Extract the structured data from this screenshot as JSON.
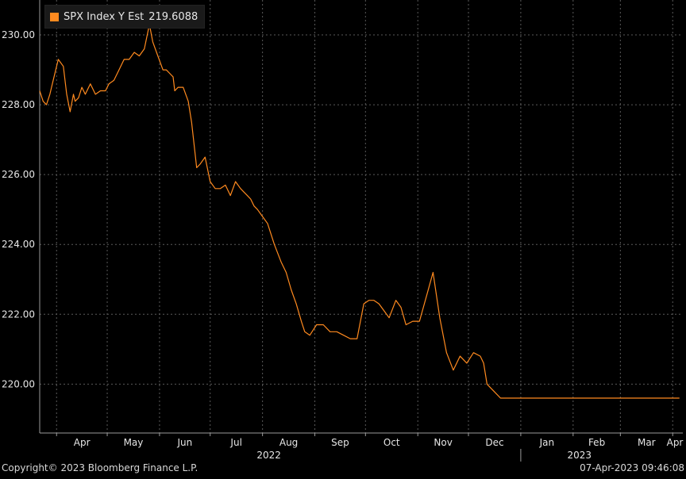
{
  "legend": {
    "label": "SPX Index Y Est",
    "value": "219.6088",
    "color": "#ff8a1f"
  },
  "footer": {
    "copyright": "Copyright© 2023 Bloomberg Finance L.P.",
    "timestamp": "07-Apr-2023 09:46:08"
  },
  "chart_data": {
    "type": "line",
    "ylim": [
      218.6,
      231.0
    ],
    "yticks": [
      220,
      222,
      224,
      226,
      228,
      230
    ],
    "ytick_labels": [
      "220.00",
      "222.00",
      "224.00",
      "226.00",
      "228.00",
      "230.00"
    ],
    "grid": true,
    "legend_position": "top-left",
    "x_range": [
      "2022-03-22",
      "2023-04-07"
    ],
    "months": [
      {
        "label": "Apr",
        "date": "2022-04-01"
      },
      {
        "label": "May",
        "date": "2022-05-01"
      },
      {
        "label": "Jun",
        "date": "2022-06-01"
      },
      {
        "label": "Jul",
        "date": "2022-07-01"
      },
      {
        "label": "Aug",
        "date": "2022-08-01"
      },
      {
        "label": "Sep",
        "date": "2022-09-01"
      },
      {
        "label": "Oct",
        "date": "2022-10-01"
      },
      {
        "label": "Nov",
        "date": "2022-11-01"
      },
      {
        "label": "Dec",
        "date": "2022-12-01"
      },
      {
        "label": "Jan",
        "date": "2023-01-01"
      },
      {
        "label": "Feb",
        "date": "2023-02-01"
      },
      {
        "label": "Mar",
        "date": "2023-03-01"
      },
      {
        "label": "Apr",
        "date": "2023-04-01"
      }
    ],
    "years": [
      {
        "label": "2022",
        "date": "2022-08-01"
      },
      {
        "label": "2023",
        "date": "2023-02-01"
      }
    ],
    "year_divider_date": "2023-01-01",
    "series": [
      {
        "color": "#ff8a1f",
        "x": [
          "2022-03-22",
          "2022-03-24",
          "2022-03-26",
          "2022-03-28",
          "2022-03-30",
          "2022-04-02",
          "2022-04-05",
          "2022-04-07",
          "2022-04-09",
          "2022-04-11",
          "2022-04-12",
          "2022-04-14",
          "2022-04-16",
          "2022-04-18",
          "2022-04-21",
          "2022-04-24",
          "2022-04-27",
          "2022-04-30",
          "2022-05-02",
          "2022-05-05",
          "2022-05-08",
          "2022-05-11",
          "2022-05-14",
          "2022-05-17",
          "2022-05-20",
          "2022-05-23",
          "2022-05-26",
          "2022-05-28",
          "2022-05-31",
          "2022-06-03",
          "2022-06-05",
          "2022-06-07",
          "2022-06-09",
          "2022-06-10",
          "2022-06-12",
          "2022-06-15",
          "2022-06-18",
          "2022-06-20",
          "2022-06-23",
          "2022-06-25",
          "2022-06-28",
          "2022-07-01",
          "2022-07-04",
          "2022-07-07",
          "2022-07-10",
          "2022-07-13",
          "2022-07-16",
          "2022-07-19",
          "2022-07-21",
          "2022-07-23",
          "2022-07-25",
          "2022-07-27",
          "2022-07-29",
          "2022-08-01",
          "2022-08-04",
          "2022-08-08",
          "2022-08-12",
          "2022-08-15",
          "2022-08-18",
          "2022-08-21",
          "2022-08-24",
          "2022-08-26",
          "2022-08-29",
          "2022-09-02",
          "2022-09-06",
          "2022-09-10",
          "2022-09-14",
          "2022-09-18",
          "2022-09-22",
          "2022-09-26",
          "2022-09-30",
          "2022-10-03",
          "2022-10-06",
          "2022-10-09",
          "2022-10-12",
          "2022-10-15",
          "2022-10-19",
          "2022-10-22",
          "2022-10-25",
          "2022-10-29",
          "2022-11-02",
          "2022-11-06",
          "2022-11-10",
          "2022-11-14",
          "2022-11-18",
          "2022-11-22",
          "2022-11-26",
          "2022-11-30",
          "2022-12-04",
          "2022-12-08",
          "2022-12-10",
          "2022-12-12",
          "2022-12-16",
          "2022-12-20",
          "2022-12-24",
          "2022-12-28",
          "2022-12-31",
          "2023-01-04",
          "2023-01-07",
          "2023-01-09",
          "2023-01-12",
          "2023-01-15",
          "2023-01-18",
          "2023-01-21",
          "2023-01-24",
          "2023-01-27",
          "2023-01-29",
          "2023-01-31",
          "2023-02-01",
          "2023-02-04",
          "2023-02-07",
          "2023-02-10",
          "2023-02-13",
          "2023-02-16",
          "2023-02-19",
          "2023-02-22",
          "2023-02-25",
          "2023-02-28",
          "2023-03-03",
          "2023-03-06",
          "2023-03-09",
          "2023-03-12",
          "2023-03-15",
          "2023-03-18",
          "2023-03-21",
          "2023-03-24",
          "2023-03-27",
          "2023-03-30",
          "2023-04-02",
          "2023-04-05"
        ],
        "y": [
          228.4,
          228.1,
          228.0,
          228.3,
          228.7,
          229.3,
          229.1,
          228.3,
          227.8,
          228.3,
          228.1,
          228.2,
          228.5,
          228.3,
          228.6,
          228.3,
          228.4,
          228.4,
          228.6,
          228.7,
          229.0,
          229.3,
          229.3,
          229.5,
          229.4,
          229.6,
          230.3,
          229.8,
          229.4,
          229.0,
          229.0,
          228.9,
          228.8,
          228.4,
          228.5,
          228.5,
          228.1,
          227.5,
          226.2,
          226.3,
          226.5,
          225.8,
          225.6,
          225.6,
          225.7,
          225.4,
          225.8,
          225.6,
          225.5,
          225.4,
          225.3,
          225.1,
          225.0,
          224.8,
          224.6,
          224.0,
          223.5,
          223.2,
          222.7,
          222.3,
          221.8,
          221.5,
          221.4,
          221.7,
          221.7,
          221.5,
          221.5,
          221.4,
          221.3,
          221.3,
          222.3,
          222.4,
          222.4,
          222.3,
          222.1,
          221.9,
          222.4,
          222.2,
          221.7,
          221.8,
          221.8,
          222.5,
          223.2,
          221.9,
          220.9,
          220.4,
          220.8,
          220.6,
          220.9,
          220.8,
          220.6,
          220.0,
          219.8,
          219.6,
          219.6,
          219.6,
          219.6,
          219.6,
          219.6,
          219.6,
          219.6,
          219.6,
          219.6,
          219.6,
          219.6,
          219.6,
          219.6,
          219.6,
          219.6,
          219.6,
          219.6,
          219.6,
          219.6,
          219.6,
          219.6,
          219.6,
          219.6,
          219.6,
          219.6,
          219.6,
          219.6,
          219.6,
          219.6,
          219.6,
          219.6,
          219.6,
          219.6,
          219.6,
          219.6,
          219.6
        ]
      }
    ]
  }
}
